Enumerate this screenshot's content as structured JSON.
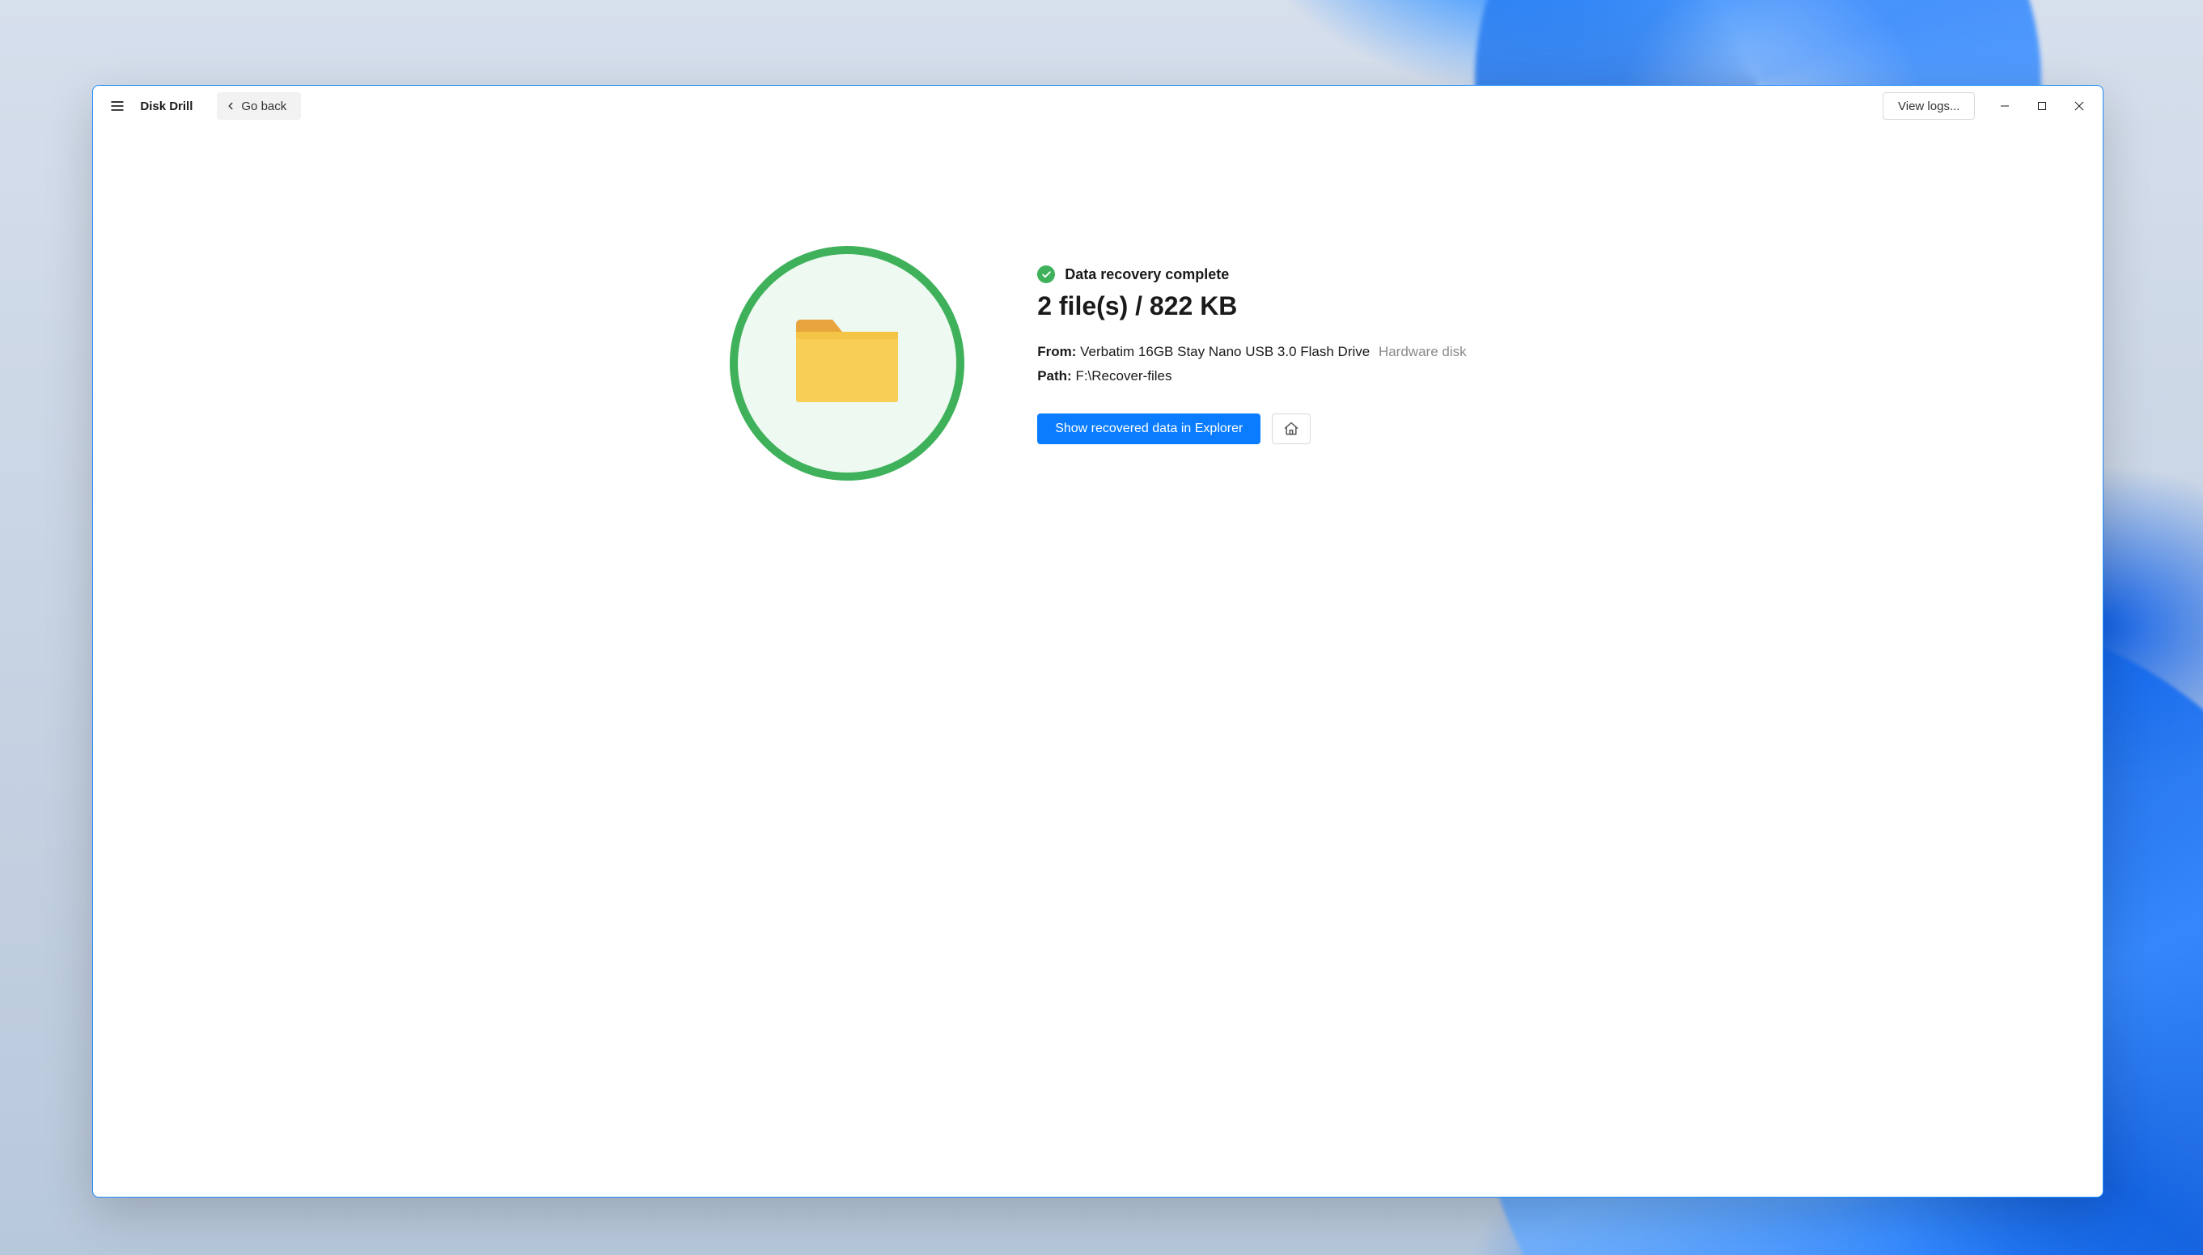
{
  "titlebar": {
    "app_title": "Disk Drill",
    "go_back_label": "Go back",
    "view_logs_label": "View logs..."
  },
  "result": {
    "status_text": "Data recovery complete",
    "summary": "2 file(s) / 822 KB",
    "from_label": "From:",
    "from_value": "Verbatim 16GB Stay Nano USB 3.0 Flash Drive",
    "from_type": "Hardware disk",
    "path_label": "Path:",
    "path_value": "F:\\Recover-files",
    "show_button_label": "Show recovered data in Explorer"
  }
}
